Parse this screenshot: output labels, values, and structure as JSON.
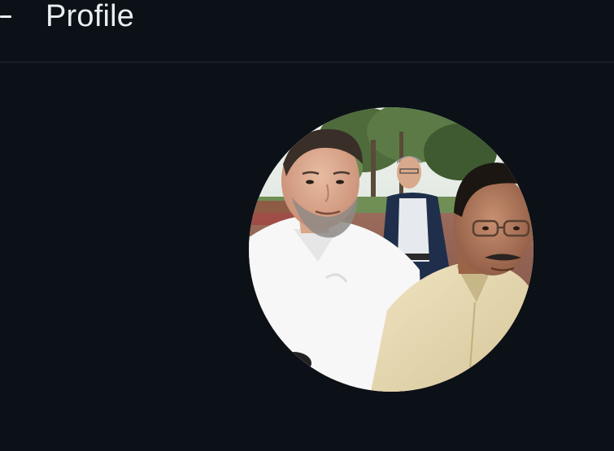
{
  "header": {
    "title": "Profile",
    "back_icon": "back-arrow-icon"
  },
  "profile_photo": {
    "icon": "profile-photo-avatar"
  },
  "colors": {
    "background": "#0b1116",
    "text": "#e9eef2",
    "divider": "#1f2a33"
  }
}
